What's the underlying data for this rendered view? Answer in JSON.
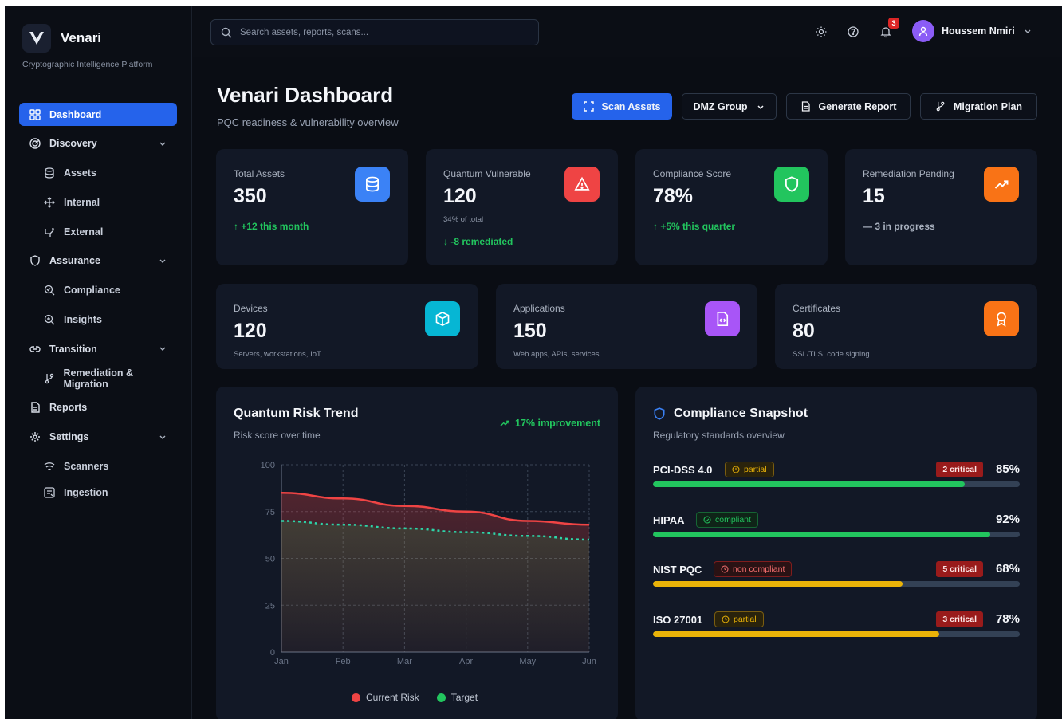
{
  "brand": {
    "name": "Venari",
    "tagline": "Cryptographic Intelligence Platform"
  },
  "search": {
    "placeholder": "Search assets, reports, scans..."
  },
  "notifications": {
    "count": "3"
  },
  "user": {
    "name": "Houssem Nmiri"
  },
  "nav": {
    "dashboard": "Dashboard",
    "discovery": "Discovery",
    "assets": "Assets",
    "internal": "Internal",
    "external": "External",
    "assurance": "Assurance",
    "compliance": "Compliance",
    "insights": "Insights",
    "transition": "Transition",
    "remediation": "Remediation & Migration",
    "reports": "Reports",
    "settings": "Settings",
    "scanners": "Scanners",
    "ingestion": "Ingestion"
  },
  "header": {
    "title": "Venari Dashboard",
    "subtitle": "PQC readiness & vulnerability overview",
    "scan_label": "Scan Assets",
    "group_label": "DMZ Group",
    "report_label": "Generate Report",
    "migration_label": "Migration Plan"
  },
  "stats": [
    {
      "label": "Total Assets",
      "value": "350",
      "note": "+12 this month"
    },
    {
      "label": "Quantum Vulnerable",
      "value": "120",
      "small": "34% of total",
      "note": "-8 remediated"
    },
    {
      "label": "Compliance Score",
      "value": "78%",
      "note": "+5% this quarter"
    },
    {
      "label": "Remediation Pending",
      "value": "15",
      "note": "3 in progress"
    }
  ],
  "categories": [
    {
      "label": "Devices",
      "value": "120",
      "small": "Servers, workstations, IoT"
    },
    {
      "label": "Applications",
      "value": "150",
      "small": "Web apps, APIs, services"
    },
    {
      "label": "Certificates",
      "value": "80",
      "small": "SSL/TLS, code signing"
    }
  ],
  "colors": {
    "accent": "#2563eb",
    "danger": "#ef4444",
    "success": "#22c55e",
    "warning": "#eab308",
    "orange": "#f97316",
    "purple": "#a855f7",
    "teal": "#06b6d4"
  },
  "risk_panel": {
    "title": "Quantum Risk Trend",
    "subtitle": "Risk score over time",
    "improvement": "17% improvement"
  },
  "chart_data": {
    "type": "area",
    "title": "Quantum Risk Trend",
    "subtitle": "Risk score over time",
    "x": [
      "Jan",
      "Feb",
      "Mar",
      "Apr",
      "May",
      "Jun"
    ],
    "y_ticks": [
      "0",
      "25",
      "50",
      "75",
      "100"
    ],
    "ylim": [
      0,
      100
    ],
    "grid": true,
    "legend_position": "bottom",
    "series": [
      {
        "name": "Current Risk",
        "values": [
          85,
          82,
          78,
          75,
          70,
          68
        ],
        "color": "#ef4444",
        "style": "solid"
      },
      {
        "name": "Target",
        "values": [
          70,
          68,
          66,
          64,
          62,
          60
        ],
        "color": "#22c55e",
        "style": "dashed"
      }
    ]
  },
  "compliance": {
    "title": "Compliance Snapshot",
    "subtitle": "Regulatory standards overview",
    "standards": [
      {
        "name": "PCI-DSS 4.0",
        "status": "partial",
        "critical": "2 critical",
        "percent": "85%",
        "value": 85,
        "color": "#22c55e"
      },
      {
        "name": "HIPAA",
        "status": "compliant",
        "critical": "",
        "percent": "92%",
        "value": 92,
        "color": "#22c55e"
      },
      {
        "name": "NIST PQC",
        "status": "non compliant",
        "critical": "5 critical",
        "percent": "68%",
        "value": 68,
        "color": "#eab308"
      },
      {
        "name": "ISO 27001",
        "status": "partial",
        "critical": "3 critical",
        "percent": "78%",
        "value": 78,
        "color": "#eab308"
      }
    ]
  }
}
